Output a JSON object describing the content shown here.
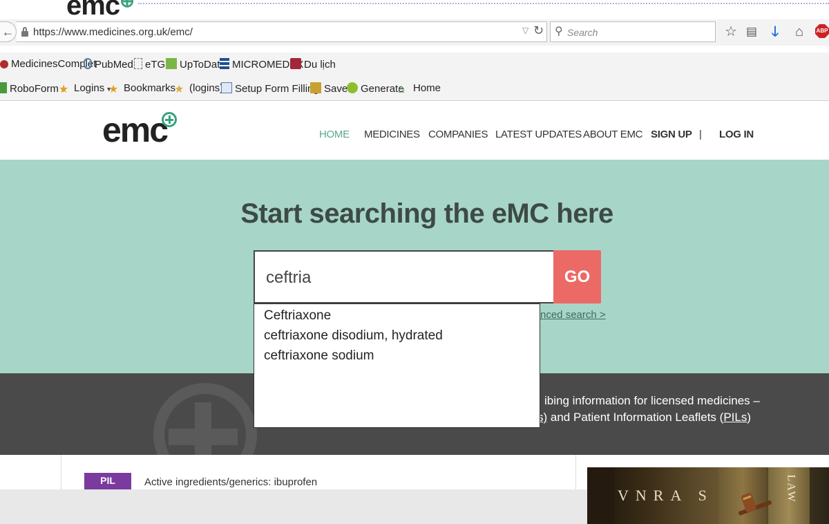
{
  "browser": {
    "url": "https://www.medicines.org.uk/emc/",
    "search_placeholder": "Search",
    "abp_label": "ABP"
  },
  "bookmarks_row1": [
    {
      "label": "MedicinesComplet",
      "icon": "medicinescomplete-icon"
    },
    {
      "label": "PubMed",
      "icon": "pubmed-icon"
    },
    {
      "label": "eTG",
      "icon": "etg-icon"
    },
    {
      "label": "UpToDate",
      "icon": "uptodate-icon"
    },
    {
      "label": "MICROMEDEX",
      "icon": "micromedex-icon"
    },
    {
      "label": "Du lịch",
      "icon": "folder-icon"
    }
  ],
  "bookmarks_row2": [
    {
      "label": "RoboForm",
      "icon": "roboform-icon",
      "dropdown": true
    },
    {
      "label": "Logins",
      "icon": "logins-icon",
      "dropdown": true
    },
    {
      "label": "Bookmarks",
      "icon": "bookmarks-icon",
      "dropdown": true
    },
    {
      "label": "(logins)",
      "icon": "logins-star-icon"
    },
    {
      "label": "Setup Form Filling",
      "icon": "form-fill-icon"
    },
    {
      "label": "Save",
      "icon": "save-icon"
    },
    {
      "label": "Generate",
      "icon": "generate-icon"
    },
    {
      "label": "Home",
      "icon": "home-icon"
    }
  ],
  "site": {
    "logo": "emc",
    "nav": {
      "home": "HOME",
      "medicines": "MEDICINES",
      "companies": "COMPANIES",
      "latest": "LATEST UPDATES",
      "about": "ABOUT EMC",
      "signup": "SIGN UP",
      "separator": "|",
      "login": "LOG IN"
    }
  },
  "hero": {
    "title": "Start searching the eMC here",
    "search_value": "ceftria",
    "go_label": "GO",
    "advanced_link": "nced search >"
  },
  "autocomplete": [
    "Ceftriaxone",
    "ceftriaxone disodium, hydrated",
    "ceftriaxone sodium"
  ],
  "band": {
    "line1": "ibing information for licensed medicines –",
    "line2_prefix": "s)",
    "line2_middle": " and Patient Information Leaflets (",
    "line2_link": "PILs",
    "line2_suffix": ")"
  },
  "bottom": {
    "badge": "PIL",
    "active_ingredients": "Active ingredients/generics: ibuprofen"
  },
  "overlay": {
    "letters": "VNRA S",
    "word": "LAW"
  },
  "colors": {
    "accent_green": "#3aa17e",
    "hero_bg": "#a7d5c7",
    "go_button": "#ec6a66",
    "dark_band": "#4a4a4a"
  }
}
